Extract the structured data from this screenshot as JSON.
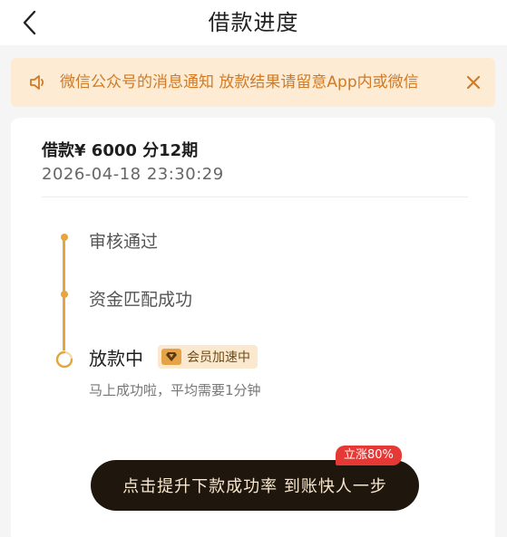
{
  "nav": {
    "title": "借款进度",
    "back_icon": "chevron-left-icon"
  },
  "notice": {
    "icon": "speaker-icon",
    "text": "微信公众号的消息通知    放款结果请留意App内或微信",
    "close_icon": "close-icon",
    "color": "#d07a25",
    "background": "#fdebd4"
  },
  "loan": {
    "title": "借款¥ 6000 分12期",
    "time": "2026-04-18 23:30:29"
  },
  "timeline": {
    "accent": "#e4a63f",
    "steps": [
      {
        "label": "审核通过"
      },
      {
        "label": "资金匹配成功"
      },
      {
        "label": "放款中"
      }
    ],
    "current_badge": "会员加速中",
    "current_sub": "马上成功啦，平均需要1分钟"
  },
  "cta": {
    "label": "点击提升下款成功率 到账快人一步",
    "tag": "立涨80%",
    "tag_color": "#e53935",
    "button_color": "#1f160e"
  }
}
